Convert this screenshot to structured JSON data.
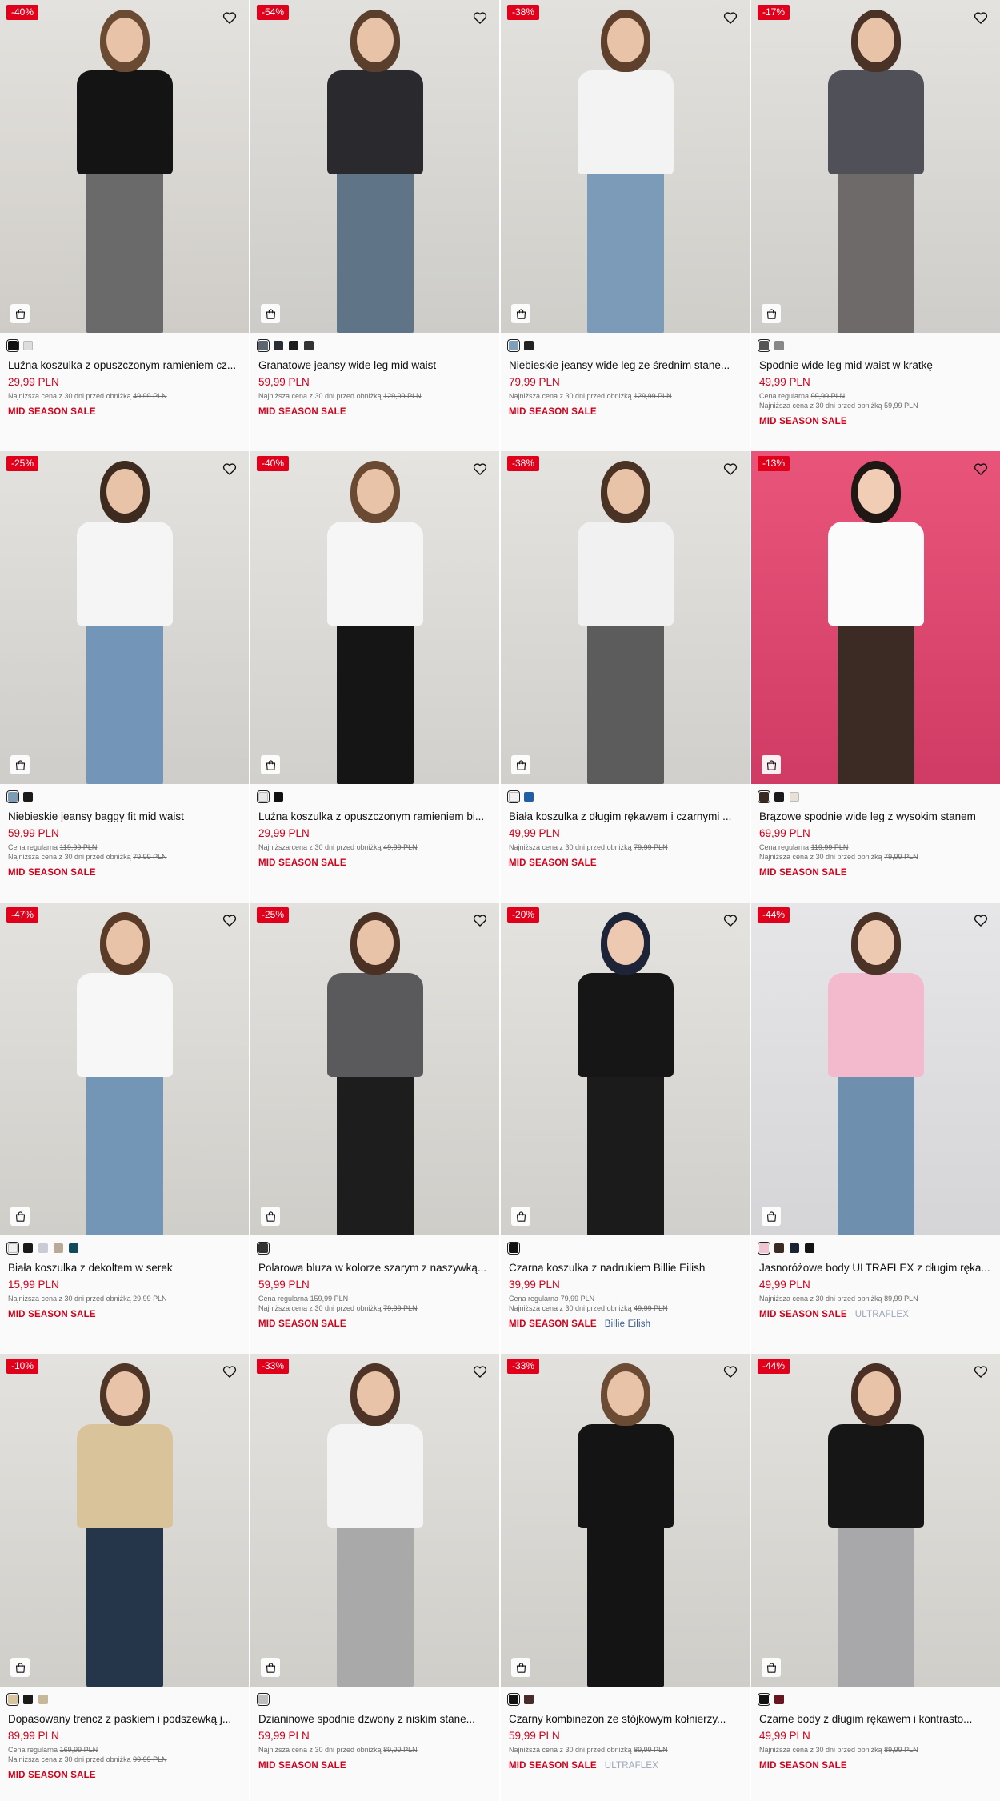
{
  "colors": {
    "accent_red": "#d0021b",
    "discount_bg": "#e0001b"
  },
  "products": [
    {
      "discount": "-40%",
      "title": "Luźna koszulka z opuszczonym ramieniem cz...",
      "price": "29,99 PLN",
      "regular_label": "",
      "regular_price": "",
      "lowest_label": "Najniższa cena z 30 dni przed obniżką",
      "lowest_price": "49,99 PLN",
      "sale": "MID SEASON SALE",
      "brand": "",
      "swatches": [
        "#111111",
        "#dddddd"
      ],
      "bg": [
        "#e4e2de",
        "#cfccc7"
      ],
      "figure": {
        "hair": "#6b4a33",
        "top": "#141414",
        "legs": "#6a6a6a",
        "skin": "#e8c3a8"
      }
    },
    {
      "discount": "-54%",
      "title": "Granatowe jeansy wide leg mid waist",
      "price": "59,99 PLN",
      "regular_label": "",
      "regular_price": "",
      "lowest_label": "Najniższa cena z 30 dni przed obniżką",
      "lowest_price": "129,99 PLN",
      "sale": "MID SEASON SALE",
      "brand": "",
      "swatches": [
        "#5b6670",
        "#2a2d33",
        "#1c1c1c",
        "#333333"
      ],
      "bg": [
        "#e1e0dc",
        "#cdccc8"
      ],
      "figure": {
        "hair": "#5a3f2c",
        "top": "#2a2a2e",
        "legs": "#5f7487",
        "skin": "#e8c3a8"
      }
    },
    {
      "discount": "-38%",
      "title": "Niebieskie jeansy wide leg ze średnim stane...",
      "price": "79,99 PLN",
      "regular_label": "",
      "regular_price": "",
      "lowest_label": "Najniższa cena z 30 dni przed obniżką",
      "lowest_price": "129,99 PLN",
      "sale": "MID SEASON SALE",
      "brand": "",
      "swatches": [
        "#7fa0b8",
        "#222222"
      ],
      "bg": [
        "#e2e1dd",
        "#cfcec9"
      ],
      "figure": {
        "hair": "#5e402d",
        "top": "#f3f3f3",
        "legs": "#7b9bb8",
        "skin": "#e8c3a8"
      }
    },
    {
      "discount": "-17%",
      "title": "Spodnie wide leg mid waist w kratkę",
      "price": "49,99 PLN",
      "regular_label": "Cena regularna",
      "regular_price": "99,99 PLN",
      "lowest_label": "Najniższa cena z 30 dni przed obniżką",
      "lowest_price": "59,99 PLN",
      "sale": "MID SEASON SALE",
      "brand": "",
      "swatches": [
        "#555555",
        "#888888"
      ],
      "bg": [
        "#e3e2de",
        "#cfcdc9"
      ],
      "figure": {
        "hair": "#4a3326",
        "top": "#505058",
        "legs": "#6e6a6a",
        "skin": "#e8c3a8"
      }
    },
    {
      "discount": "-25%",
      "title": "Niebieskie jeansy baggy fit mid waist",
      "price": "59,99 PLN",
      "regular_label": "Cena regularna",
      "regular_price": "119,99 PLN",
      "lowest_label": "Najniższa cena z 30 dni przed obniżką",
      "lowest_price": "79,99 PLN",
      "sale": "MID SEASON SALE",
      "brand": "",
      "swatches": [
        "#7d9bb3",
        "#1a1a1a"
      ],
      "bg": [
        "#e3e2de",
        "#cfcdc9"
      ],
      "figure": {
        "hair": "#3e2b20",
        "top": "#f5f5f5",
        "legs": "#7396b8",
        "skin": "#e8c3a8"
      }
    },
    {
      "discount": "-40%",
      "title": "Luźna koszulka z opuszczonym ramieniem bi...",
      "price": "29,99 PLN",
      "regular_label": "",
      "regular_price": "",
      "lowest_label": "Najniższa cena z 30 dni przed obniżką",
      "lowest_price": "49,99 PLN",
      "sale": "MID SEASON SALE",
      "brand": "",
      "swatches": [
        "#e8e8e8",
        "#111111"
      ],
      "bg": [
        "#e5e4e0",
        "#d2d0cc"
      ],
      "figure": {
        "hair": "#6b4a33",
        "top": "#f6f6f6",
        "legs": "#151515",
        "skin": "#e8c3a8"
      }
    },
    {
      "discount": "-38%",
      "title": "Biała koszulka z długim rękawem i czarnymi ...",
      "price": "49,99 PLN",
      "regular_label": "",
      "regular_price": "",
      "lowest_label": "Najniższa cena z 30 dni przed obniżką",
      "lowest_price": "79,99 PLN",
      "sale": "MID SEASON SALE",
      "brand": "",
      "swatches": [
        "#f2f2f2",
        "#1f5fa8"
      ],
      "bg": [
        "#e4e3df",
        "#d1cfcb"
      ],
      "figure": {
        "hair": "#4a3225",
        "top": "#f1f1f1",
        "legs": "#5c5c5c",
        "skin": "#e8c3a8"
      }
    },
    {
      "discount": "-13%",
      "title": "Brązowe spodnie wide leg z wysokim stanem",
      "price": "69,99 PLN",
      "regular_label": "Cena regularna",
      "regular_price": "119,99 PLN",
      "lowest_label": "Najniższa cena z 30 dni przed obniżką",
      "lowest_price": "79,99 PLN",
      "sale": "MID SEASON SALE",
      "brand": "",
      "swatches": [
        "#3b2a22",
        "#1a1a1a",
        "#e7e2d5"
      ],
      "bg": [
        "#e9557a",
        "#cf3b64"
      ],
      "figure": {
        "hair": "#1f1714",
        "top": "#fbfbfb",
        "legs": "#3c2a24",
        "skin": "#f0cdb4"
      }
    },
    {
      "discount": "-47%",
      "title": "Biała koszulka z dekoltem w serek",
      "price": "15,99 PLN",
      "regular_label": "",
      "regular_price": "",
      "lowest_label": "Najniższa cena z 30 dni przed obniżką",
      "lowest_price": "29,99 PLN",
      "sale": "MID SEASON SALE",
      "brand": "",
      "swatches": [
        "#f0f0f0",
        "#1a1a1a",
        "#c9ccd6",
        "#b8aa98",
        "#124a5c"
      ],
      "bg": [
        "#e3e2de",
        "#d0cec9"
      ],
      "figure": {
        "hair": "#5a3b28",
        "top": "#f7f7f7",
        "legs": "#7395b6",
        "skin": "#e8c3a8"
      }
    },
    {
      "discount": "-25%",
      "title": "Polarowa bluza w kolorze szarym z naszywką...",
      "price": "59,99 PLN",
      "regular_label": "Cena regularna",
      "regular_price": "159,99 PLN",
      "lowest_label": "Najniższa cena z 30 dni przed obniżką",
      "lowest_price": "79,99 PLN",
      "sale": "MID SEASON SALE",
      "brand": "",
      "swatches": [
        "#333333"
      ],
      "bg": [
        "#e2e1dd",
        "#cfcdc8"
      ],
      "figure": {
        "hair": "#4a3123",
        "top": "#5a5a5c",
        "legs": "#1d1d1d",
        "skin": "#e8c3a8"
      }
    },
    {
      "discount": "-20%",
      "title": "Czarna koszulka z nadrukiem Billie Eilish",
      "price": "39,99 PLN",
      "regular_label": "Cena regularna",
      "regular_price": "79,99 PLN",
      "lowest_label": "Najniższa cena z 30 dni przed obniżką",
      "lowest_price": "49,99 PLN",
      "sale": "MID SEASON SALE",
      "brand": "Billie Eilish",
      "brand_light": false,
      "swatches": [
        "#111111"
      ],
      "bg": [
        "#e4e3df",
        "#d1cfcb"
      ],
      "figure": {
        "hair": "#1e2438",
        "top": "#161616",
        "legs": "#1b1b1b",
        "skin": "#ecc9b0"
      }
    },
    {
      "discount": "-44%",
      "title": "Jasnoróżowe body ULTRAFLEX z długim ręka...",
      "price": "49,99 PLN",
      "regular_label": "",
      "regular_price": "",
      "lowest_label": "Najniższa cena z 30 dni przed obniżką",
      "lowest_price": "89,99 PLN",
      "sale": "MID SEASON SALE",
      "brand": "ULTRAFLEX",
      "brand_light": true,
      "swatches": [
        "#f1c4d2",
        "#3a2a22",
        "#1b2233",
        "#141414"
      ],
      "bg": [
        "#e6e6e8",
        "#d5d5d8"
      ],
      "figure": {
        "hair": "#4b3226",
        "top": "#f3b9cd",
        "legs": "#6f8fae",
        "skin": "#ecc9b0"
      }
    },
    {
      "discount": "-10%",
      "title": "Dopasowany trencz z paskiem i podszewką j...",
      "price": "89,99 PLN",
      "regular_label": "Cena regularna",
      "regular_price": "169,99 PLN",
      "lowest_label": "Najniższa cena z 30 dni przed obniżką",
      "lowest_price": "99,99 PLN",
      "sale": "MID SEASON SALE",
      "brand": "",
      "swatches": [
        "#d8c4a1",
        "#1a1a1a",
        "#c8b89a"
      ],
      "bg": [
        "#e3e2de",
        "#d0cec9"
      ],
      "figure": {
        "hair": "#4f3526",
        "top": "#d9c39b",
        "legs": "#26364a",
        "skin": "#e8c3a8"
      }
    },
    {
      "discount": "-33%",
      "title": "Dzianinowe spodnie dzwony z niskim stane...",
      "price": "59,99 PLN",
      "regular_label": "",
      "regular_price": "",
      "lowest_label": "Najniższa cena z 30 dni przed obniżką",
      "lowest_price": "89,99 PLN",
      "sale": "MID SEASON SALE",
      "brand": "",
      "swatches": [
        "#bdbdbd"
      ],
      "bg": [
        "#e3e2de",
        "#d0cec9"
      ],
      "figure": {
        "hair": "#4e3426",
        "top": "#f4f4f4",
        "legs": "#a9a9a9",
        "skin": "#e8c3a8"
      }
    },
    {
      "discount": "-33%",
      "title": "Czarny kombinezon ze stójkowym kołnierzy...",
      "price": "59,99 PLN",
      "regular_label": "",
      "regular_price": "",
      "lowest_label": "Najniższa cena z 30 dni przed obniżką",
      "lowest_price": "89,99 PLN",
      "sale": "MID SEASON SALE",
      "brand": "ULTRAFLEX",
      "brand_light": true,
      "swatches": [
        "#111111",
        "#4a2a2a"
      ],
      "bg": [
        "#e2e1dd",
        "#cfcdc8"
      ],
      "figure": {
        "hair": "#6b4b34",
        "top": "#141414",
        "legs": "#141414",
        "skin": "#e8c3a8"
      }
    },
    {
      "discount": "-44%",
      "title": "Czarne body z długim rękawem i kontrasto...",
      "price": "49,99 PLN",
      "regular_label": "",
      "regular_price": "",
      "lowest_label": "Najniższa cena z 30 dni przed obniżką",
      "lowest_price": "89,99 PLN",
      "sale": "MID SEASON SALE",
      "brand": "",
      "swatches": [
        "#111111",
        "#6a1420"
      ],
      "bg": [
        "#e3e2de",
        "#d0cec9"
      ],
      "figure": {
        "hair": "#4a3024",
        "top": "#161616",
        "legs": "#a8a8aa",
        "skin": "#e8c3a8"
      }
    }
  ]
}
